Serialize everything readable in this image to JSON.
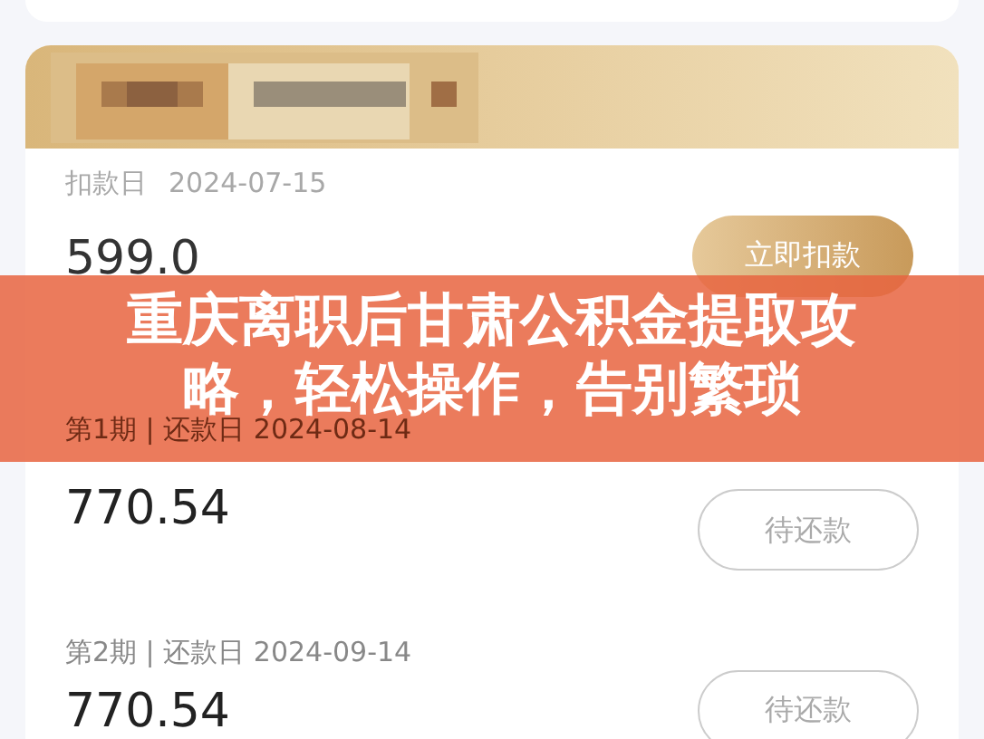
{
  "deduction": {
    "label": "扣款日",
    "date": "2024-07-15",
    "amount": "599.0",
    "button": "立即扣款"
  },
  "installments": [
    {
      "period": "第1期 | 还款日 2024-08-14",
      "amount": "770.54",
      "button": "待还款"
    },
    {
      "period": "第2期 | 还款日 2024-09-14",
      "amount": "770.54",
      "button": "待还款"
    }
  ],
  "banner": {
    "title": "重庆离职后甘肃公积金提取攻略，轻松操作，告别繁琐"
  }
}
